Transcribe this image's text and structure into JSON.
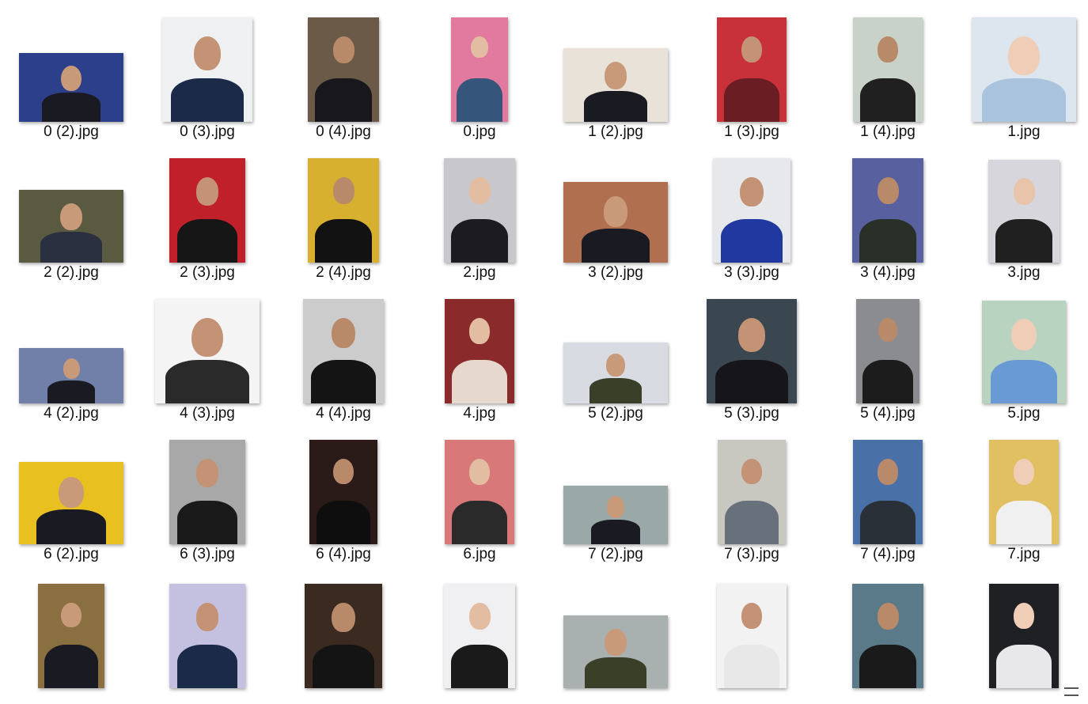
{
  "files": [
    {
      "name": "0 (2).jpg",
      "w": 132,
      "h": 87,
      "bg": "#2b3f8a",
      "skin": "#c89a7a",
      "suit": "#1a1a22"
    },
    {
      "name": "0 (3).jpg",
      "w": 114,
      "h": 132,
      "bg": "#eef0f2",
      "skin": "#c49274",
      "suit": "#1c2a4a"
    },
    {
      "name": "0 (4).jpg",
      "w": 90,
      "h": 132,
      "bg": "#6b5a48",
      "skin": "#b88a6a",
      "suit": "#18181c"
    },
    {
      "name": "0.jpg",
      "w": 72,
      "h": 132,
      "bg": "#e27aa0",
      "skin": "#e3bda2",
      "suit": "#35557a"
    },
    {
      "name": "1 (2).jpg",
      "w": 132,
      "h": 93,
      "bg": "#e8e2d8",
      "skin": "#c89a7a",
      "suit": "#1a1a22"
    },
    {
      "name": "1 (3).jpg",
      "w": 88,
      "h": 132,
      "bg": "#c8303a",
      "skin": "#c49274",
      "suit": "#6a1e24"
    },
    {
      "name": "1 (4).jpg",
      "w": 88,
      "h": 132,
      "bg": "#c8d2c8",
      "skin": "#b88a6a",
      "suit": "#202020"
    },
    {
      "name": "1.jpg",
      "w": 132,
      "h": 132,
      "bg": "#dde6ee",
      "skin": "#efcdb6",
      "suit": "#aac4de"
    },
    {
      "name": "2 (2).jpg",
      "w": 132,
      "h": 92,
      "bg": "#5a5a40",
      "skin": "#c89a7a",
      "suit": "#2a3040"
    },
    {
      "name": "2 (3).jpg",
      "w": 96,
      "h": 132,
      "bg": "#c0202a",
      "skin": "#c49274",
      "suit": "#161616"
    },
    {
      "name": "2 (4).jpg",
      "w": 90,
      "h": 132,
      "bg": "#d8b030",
      "skin": "#b88a6a",
      "suit": "#121212"
    },
    {
      "name": "2.jpg",
      "w": 90,
      "h": 132,
      "bg": "#c8c8cc",
      "skin": "#e3bda2",
      "suit": "#1c1c20"
    },
    {
      "name": "3 (2).jpg",
      "w": 132,
      "h": 102,
      "bg": "#b07050",
      "skin": "#c89a7a",
      "suit": "#1a1a22"
    },
    {
      "name": "3 (3).jpg",
      "w": 98,
      "h": 132,
      "bg": "#e6e8ec",
      "skin": "#c49274",
      "suit": "#2038a0"
    },
    {
      "name": "3 (4).jpg",
      "w": 90,
      "h": 132,
      "bg": "#5860a0",
      "skin": "#b88a6a",
      "suit": "#283028"
    },
    {
      "name": "3.jpg",
      "w": 90,
      "h": 130,
      "bg": "#d6d6dc",
      "skin": "#e8c4aa",
      "suit": "#202020"
    },
    {
      "name": "4 (2).jpg",
      "w": 132,
      "h": 70,
      "bg": "#7080a8",
      "skin": "#c89a7a",
      "suit": "#1a1a22"
    },
    {
      "name": "4 (3).jpg",
      "w": 132,
      "h": 132,
      "bg": "#f4f4f4",
      "skin": "#c49274",
      "suit": "#2a2a2a"
    },
    {
      "name": "4 (4).jpg",
      "w": 102,
      "h": 132,
      "bg": "#cccccc",
      "skin": "#b88a6a",
      "suit": "#141414"
    },
    {
      "name": "4.jpg",
      "w": 88,
      "h": 132,
      "bg": "#8a2a2a",
      "skin": "#e3bda2",
      "suit": "#e6d8cc"
    },
    {
      "name": "5 (2).jpg",
      "w": 132,
      "h": 77,
      "bg": "#d8dce2",
      "skin": "#c89a7a",
      "suit": "#3a4028"
    },
    {
      "name": "5 (3).jpg",
      "w": 114,
      "h": 132,
      "bg": "#3a4650",
      "skin": "#c49274",
      "suit": "#16161a"
    },
    {
      "name": "5 (4).jpg",
      "w": 80,
      "h": 132,
      "bg": "#8a8c90",
      "skin": "#b88a6a",
      "suit": "#1c1c1c"
    },
    {
      "name": "5.jpg",
      "w": 106,
      "h": 130,
      "bg": "#b8d4c0",
      "skin": "#efcdb6",
      "suit": "#6a9ad4"
    },
    {
      "name": "6 (2).jpg",
      "w": 132,
      "h": 104,
      "bg": "#e8c020",
      "skin": "#c89a7a",
      "suit": "#1a1a22"
    },
    {
      "name": "6 (3).jpg",
      "w": 96,
      "h": 132,
      "bg": "#a8a8a8",
      "skin": "#c49274",
      "suit": "#1a1a1a"
    },
    {
      "name": "6 (4).jpg",
      "w": 86,
      "h": 132,
      "bg": "#2a1a18",
      "skin": "#b88a6a",
      "suit": "#0e0e0e"
    },
    {
      "name": "6.jpg",
      "w": 88,
      "h": 132,
      "bg": "#d87878",
      "skin": "#e3bda2",
      "suit": "#2a2a2a"
    },
    {
      "name": "7 (2).jpg",
      "w": 132,
      "h": 74,
      "bg": "#9aa8a8",
      "skin": "#c89a7a",
      "suit": "#1a1a22"
    },
    {
      "name": "7 (3).jpg",
      "w": 86,
      "h": 132,
      "bg": "#c8c8c0",
      "skin": "#c49274",
      "suit": "#68707c"
    },
    {
      "name": "7 (4).jpg",
      "w": 88,
      "h": 132,
      "bg": "#4a70a8",
      "skin": "#b88a6a",
      "suit": "#2a3038"
    },
    {
      "name": "7.jpg",
      "w": 88,
      "h": 132,
      "bg": "#e0c060",
      "skin": "#efcdb6",
      "suit": "#f0f0f0"
    },
    {
      "name": "",
      "w": 84,
      "h": 132,
      "bg": "#8a7040",
      "skin": "#c89a7a",
      "suit": "#1a1a22"
    },
    {
      "name": "",
      "w": 96,
      "h": 132,
      "bg": "#c4c0e0",
      "skin": "#c49274",
      "suit": "#1c2a4a"
    },
    {
      "name": "",
      "w": 98,
      "h": 132,
      "bg": "#3a2a20",
      "skin": "#b88a6a",
      "suit": "#141414"
    },
    {
      "name": "",
      "w": 90,
      "h": 132,
      "bg": "#f0f0f2",
      "skin": "#e3bda2",
      "suit": "#1a1a1a"
    },
    {
      "name": "",
      "w": 132,
      "h": 92,
      "bg": "#a8b0b0",
      "skin": "#c89a7a",
      "suit": "#3a4028"
    },
    {
      "name": "",
      "w": 88,
      "h": 132,
      "bg": "#f2f2f2",
      "skin": "#c49274",
      "suit": "#e8e8e8"
    },
    {
      "name": "",
      "w": 90,
      "h": 132,
      "bg": "#5a7a8a",
      "skin": "#b88a6a",
      "suit": "#1a1a1a"
    },
    {
      "name": "",
      "w": 88,
      "h": 132,
      "bg": "#1e2024",
      "skin": "#efcdb6",
      "suit": "#e8e8ea"
    }
  ]
}
